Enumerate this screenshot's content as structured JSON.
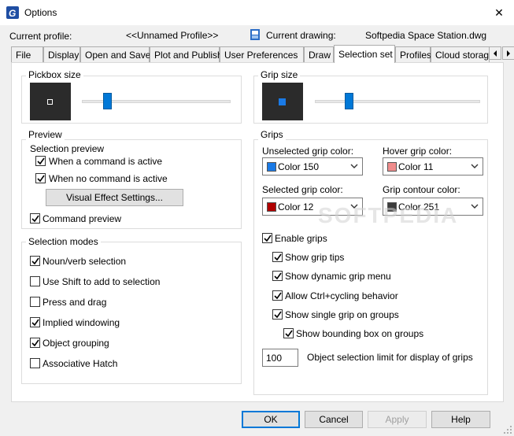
{
  "window": {
    "title": "Options",
    "close_glyph": "✕"
  },
  "profile": {
    "current_profile_label": "Current profile:",
    "current_profile_value": "<<Unnamed Profile>>",
    "current_drawing_label": "Current drawing:",
    "current_drawing_value": "Softpedia Space Station.dwg"
  },
  "tabs": [
    {
      "label": "File"
    },
    {
      "label": "Display"
    },
    {
      "label": "Open and Save"
    },
    {
      "label": "Plot and Publish"
    },
    {
      "label": "User Preferences"
    },
    {
      "label": "Draw"
    },
    {
      "label": "Selection set"
    },
    {
      "label": "Profiles"
    },
    {
      "label": "Cloud storage"
    }
  ],
  "active_tab": "Selection set",
  "pickbox": {
    "title": "Pickbox size",
    "slider_level": 0.17
  },
  "grip_size": {
    "title": "Grip size",
    "slider_level": 0.2
  },
  "preview": {
    "title": "Preview",
    "subtitle": "Selection preview",
    "when_active": {
      "label": "When a command is active",
      "checked": true
    },
    "when_no_command": {
      "label": "When no command is active",
      "checked": true
    },
    "visual_effect_button": "Visual Effect Settings...",
    "command_preview": {
      "label": "Command preview",
      "checked": true
    }
  },
  "selection_modes": {
    "title": "Selection modes",
    "items": [
      {
        "label": "Noun/verb selection",
        "checked": true
      },
      {
        "label": "Use Shift to add to selection",
        "checked": false
      },
      {
        "label": "Press and drag",
        "checked": false
      },
      {
        "label": "Implied windowing",
        "checked": true
      },
      {
        "label": "Object grouping",
        "checked": true
      },
      {
        "label": "Associative Hatch",
        "checked": false
      }
    ]
  },
  "grips": {
    "title": "Grips",
    "unselected": {
      "label": "Unselected grip color:",
      "value": "Color 150",
      "color": "#1a7ae6"
    },
    "hover": {
      "label": "Hover grip color:",
      "value": "Color 11",
      "color": "#f08c8c"
    },
    "selected": {
      "label": "Selected grip color:",
      "value": "Color 12",
      "color": "#b00000"
    },
    "contour": {
      "label": "Grip contour color:",
      "value": "Color 251",
      "color": "#3c3c3c"
    },
    "enable_grips": {
      "label": "Enable grips",
      "checked": true
    },
    "grip_tips": {
      "label": "Show grip tips",
      "checked": true
    },
    "dynamic_menu": {
      "label": "Show dynamic grip menu",
      "checked": true
    },
    "ctrl_cycling": {
      "label": "Allow Ctrl+cycling behavior",
      "checked": true
    },
    "single_grip": {
      "label": "Show single grip on groups",
      "checked": true
    },
    "bounding_box": {
      "label": "Show bounding box on groups",
      "checked": true
    },
    "limit_value": "100",
    "limit_label": "Object selection limit for display of grips"
  },
  "watermark": "SOFTPEDIA",
  "buttons": {
    "ok": "OK",
    "cancel": "Cancel",
    "apply": "Apply",
    "help": "Help"
  },
  "colors": {
    "accent": "#0078d7",
    "grip_blue": "#1a7ae6"
  }
}
